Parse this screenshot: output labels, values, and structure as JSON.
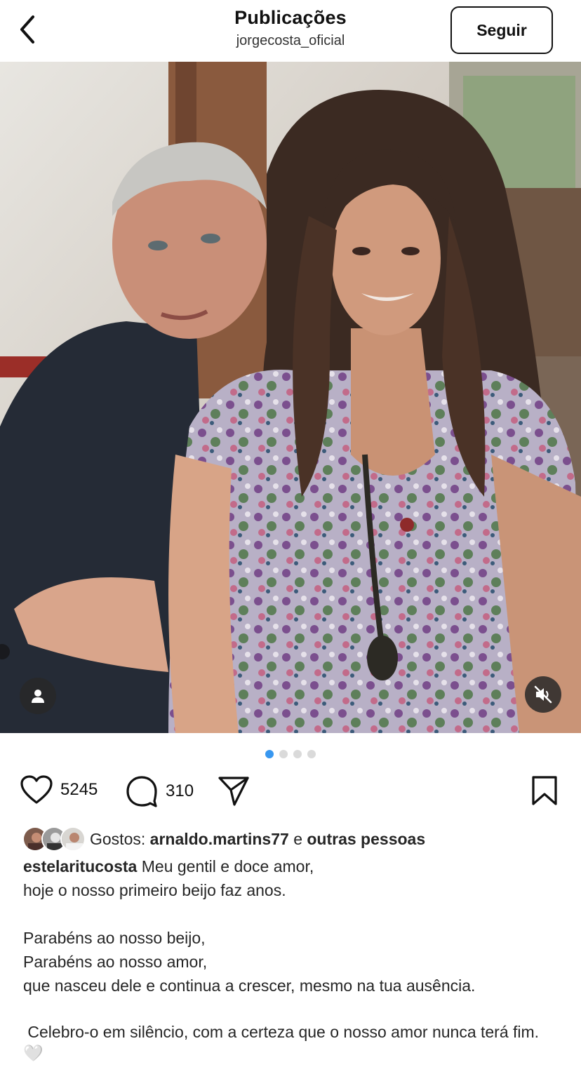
{
  "header": {
    "title": "Publicações",
    "username": "jorgecosta_oficial",
    "follow_label": "Seguir"
  },
  "post": {
    "carousel": {
      "count": 4,
      "active_index": 0
    },
    "likes_count": "5245",
    "comments_count": "310",
    "likes_prefix": "Gostos:",
    "liked_by": "arnaldo.martins77",
    "likes_joiner": "e",
    "likes_others": "outras pessoas",
    "caption_author": "estelaritucosta",
    "caption_lines": [
      "Meu gentil e doce amor,",
      "hoje o nosso primeiro beijo faz anos.",
      "",
      "Parabéns ao nosso beijo,",
      "Parabéns ao nosso amor,",
      "que nasceu dele e continua a crescer, mesmo na tua ausência.",
      "",
      " Celebro-o em silêncio, com a certeza que o nosso amor nunca terá fim. 🤍"
    ]
  },
  "icons": {
    "back": "chevron-left-icon",
    "tag": "person-icon",
    "mute": "speaker-muted-icon",
    "like": "heart-icon",
    "comment": "comment-bubble-icon",
    "share": "paper-plane-icon",
    "save": "bookmark-icon"
  },
  "colors": {
    "accent_dot": "#3897f0",
    "text": "#262626"
  }
}
